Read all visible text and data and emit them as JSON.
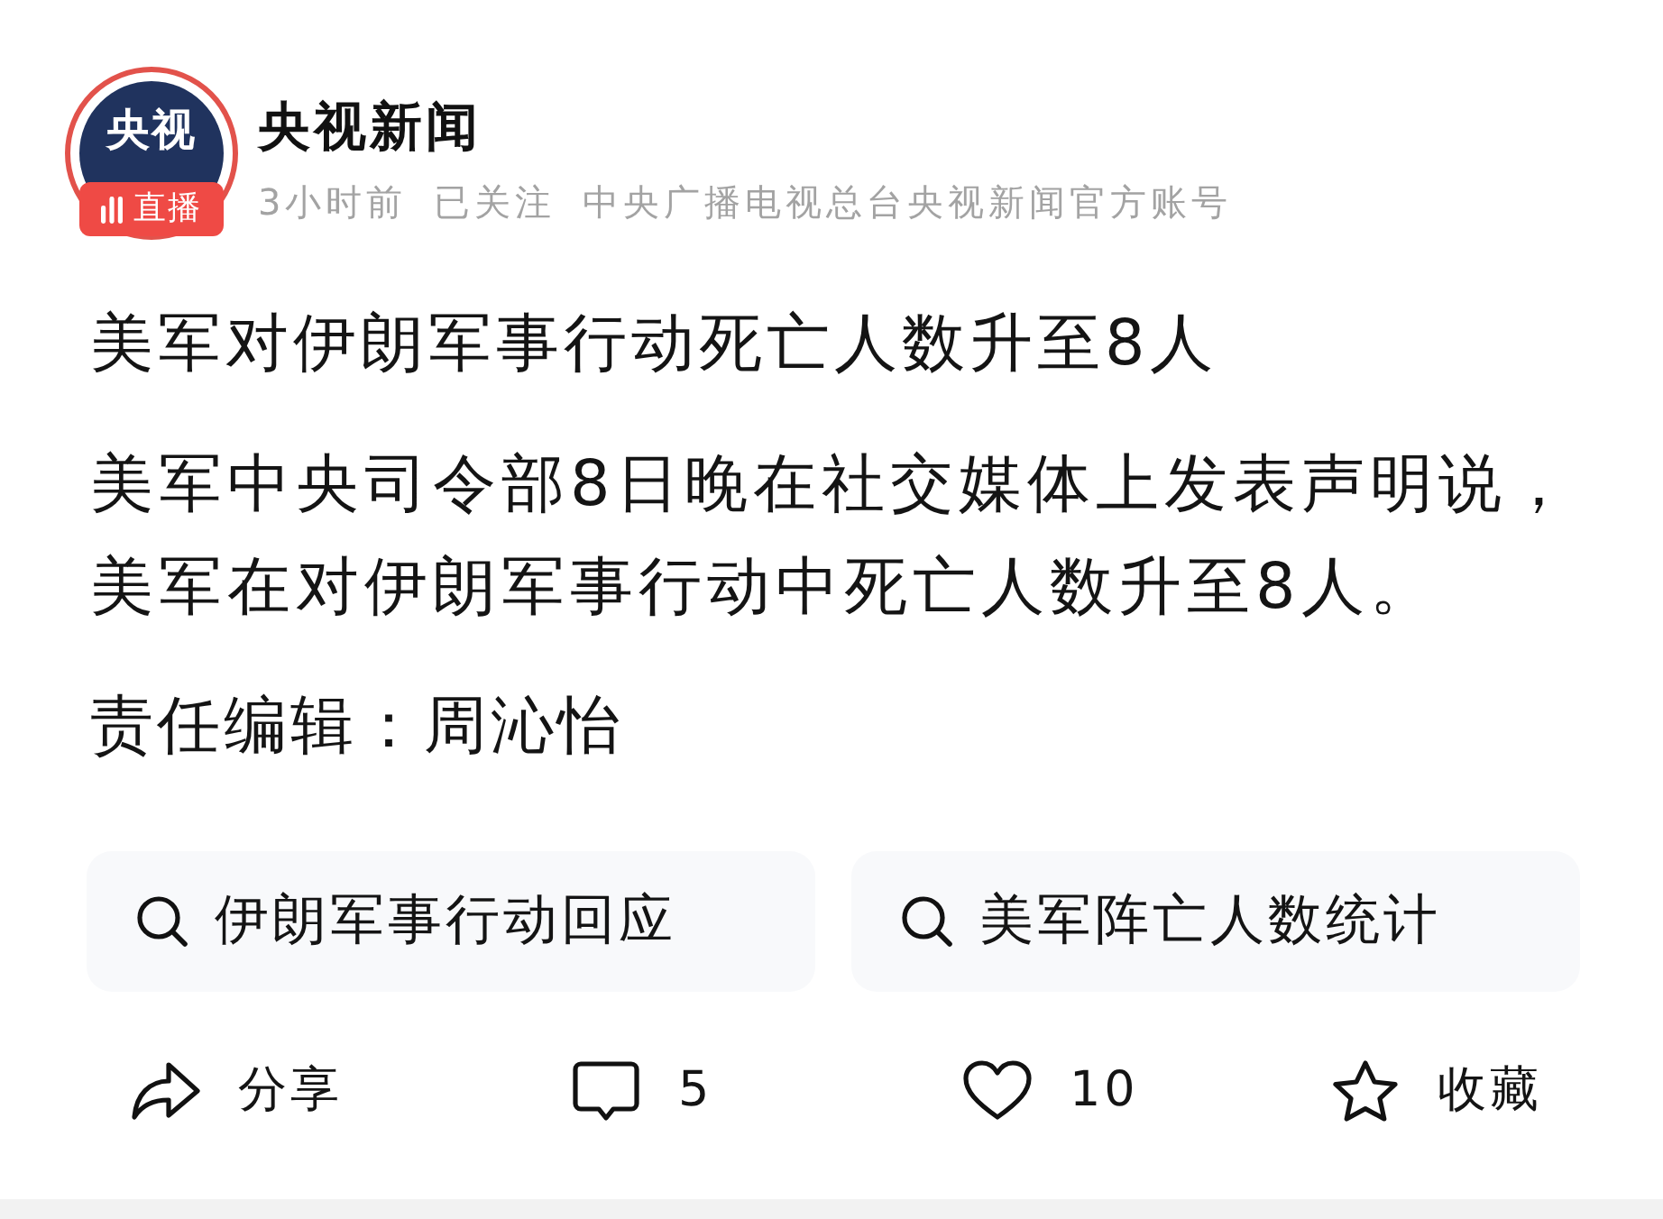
{
  "account": {
    "avatar": {
      "logo_text": "央视",
      "live_badge": "直播"
    },
    "name": "央视新闻",
    "time": "3小时前",
    "follow_status": "已关注",
    "description": "中央广播电视总台央视新闻官方账号"
  },
  "article": {
    "headline": "美军对伊朗军事行动死亡人数升至8人",
    "body": "美军中央司令部8日晚在社交媒体上发表声明说，美军在对伊朗军事行动中死亡人数升至8人。",
    "editor": "责任编辑：周沁怡"
  },
  "related_searches": [
    {
      "label": "伊朗军事行动回应"
    },
    {
      "label": "美军阵亡人数统计"
    }
  ],
  "actions": [
    {
      "kind": "share",
      "label": "分享"
    },
    {
      "kind": "comment",
      "label": "5"
    },
    {
      "kind": "like",
      "label": "10"
    },
    {
      "kind": "collect",
      "label": "收藏"
    }
  ]
}
